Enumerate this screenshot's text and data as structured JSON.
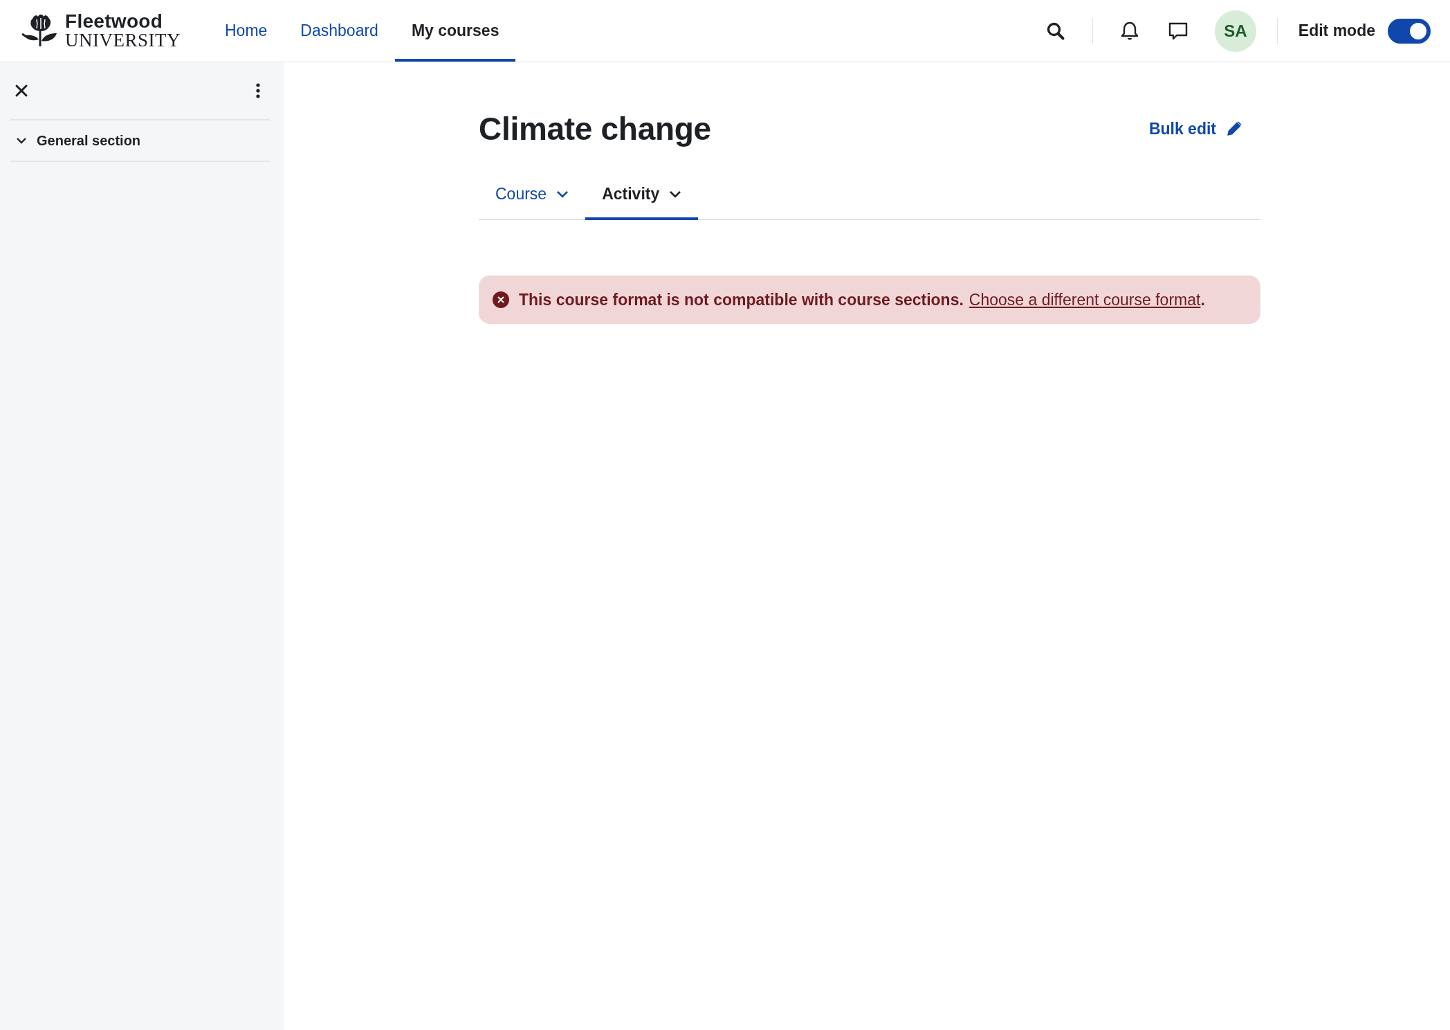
{
  "header": {
    "logo": {
      "name": "Fleetwood",
      "subtitle": "UNIVERSITY"
    },
    "nav": [
      {
        "label": "Home",
        "selected": false
      },
      {
        "label": "Dashboard",
        "selected": false
      },
      {
        "label": "My courses",
        "selected": true
      }
    ],
    "avatar": "SA",
    "edit_mode": {
      "label": "Edit mode",
      "on": true
    }
  },
  "sidebar": {
    "sections": [
      {
        "title": "General section",
        "expanded": true
      }
    ]
  },
  "main": {
    "title": "Climate change",
    "bulk_edit": "Bulk edit",
    "tabs": [
      {
        "label": "Course",
        "selected": false
      },
      {
        "label": "Activity",
        "selected": true
      }
    ],
    "alert": {
      "message": "This course format is not compatible with course sections.",
      "link": "Choose a different course format",
      "after_link": "."
    }
  }
}
